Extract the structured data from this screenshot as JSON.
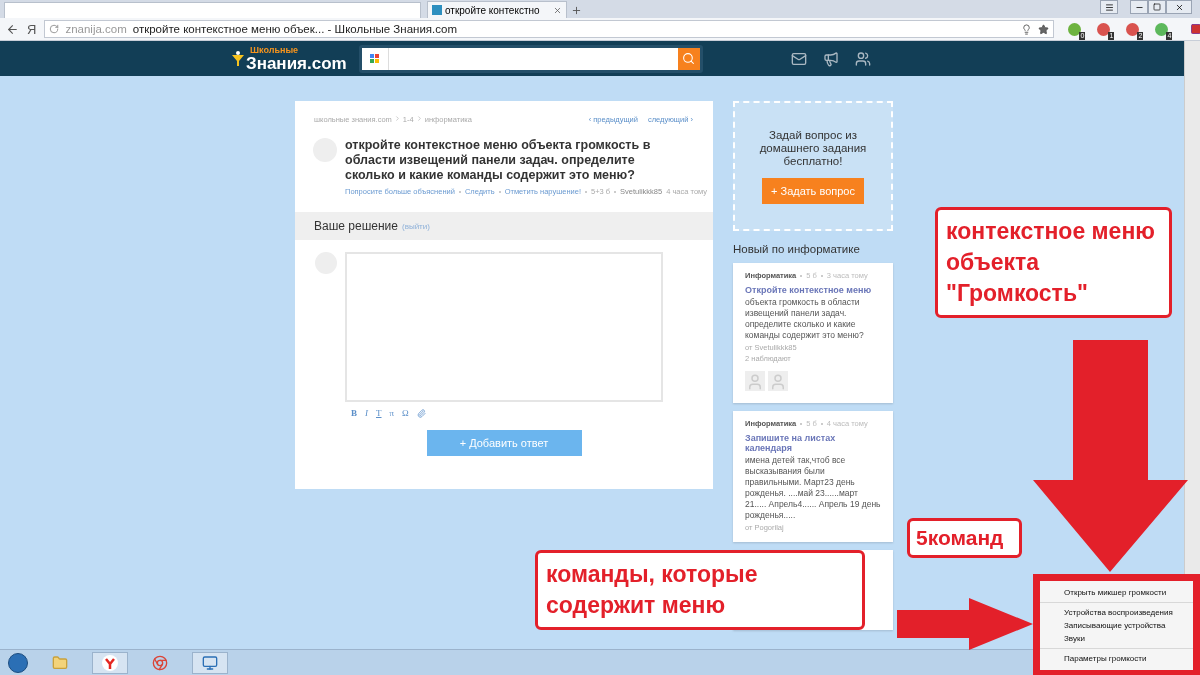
{
  "browser": {
    "tab": {
      "title": "откройте контекстно",
      "selected": true
    },
    "address": {
      "domain": "znanija.com",
      "title": "откройте контекстное меню объек... - Школьные Знания.com"
    },
    "back_label": "Я",
    "extensions": [
      {
        "badge": "0",
        "color": "#6db33f"
      },
      {
        "badge": "1",
        "color": "#d9534f"
      },
      {
        "badge": "2",
        "color": "#d9534f"
      },
      {
        "badge": "4",
        "color": "#5cb85c"
      }
    ]
  },
  "site": {
    "logo_top": "Школьные",
    "logo_main": "Знания.com"
  },
  "question": {
    "breadcrumbs": [
      "школьные знания.com",
      "1-4",
      "информатика"
    ],
    "prev": "‹ предыдущий",
    "next": "следующий ›",
    "title": "откройте контекстное меню объекта громкость в области извещений панели задач. определите сколько и какие команды содержит это меню?",
    "meta": [
      {
        "kind": "link",
        "text": "Попросите больше объяснений"
      },
      {
        "kind": "link",
        "text": "Следить"
      },
      {
        "kind": "link",
        "text": "Отметить нарушение!"
      },
      {
        "kind": "plain",
        "text": "5+3 б"
      },
      {
        "kind": "author",
        "text": "Svetulikkk85",
        "after": "4 часа тому"
      }
    ]
  },
  "answer": {
    "heading": "Ваше решение",
    "logout": "(выйти)",
    "tools": [
      "B",
      "I",
      "T",
      "π",
      "Ω"
    ],
    "submit": "+ Добавить ответ"
  },
  "ask": {
    "text": "Задай вопрос из домашнего задания бесплатно!",
    "button": "+ Задать вопрос"
  },
  "sidebar": {
    "heading": "Новый по информатике",
    "cards": [
      {
        "subject": "Информатика",
        "points": "5 б",
        "time": "3 часа тому",
        "title": "Откройте контекстное меню",
        "body": "объекта громкость в области извещений панели задач. определите сколько и какие команды содержит это меню?",
        "author": "от Svetulikkk85",
        "watchers": "2 наблюдают"
      },
      {
        "subject": "Информатика",
        "points": "5 б",
        "time": "4 часа тому",
        "title": "Запишите на листах календаря",
        "body": "имена детей так,чтоб все высказывания были правильными. Март23 день рожденья. ....май 23......март 21..... Апрель4...... Апрель 19 день рожденья.....",
        "author": "от Pogorilaj"
      }
    ]
  },
  "annotations": [
    {
      "kind": "callout",
      "text": "контекстное меню объекта \"Громкость\""
    },
    {
      "kind": "count",
      "text": "5команд"
    },
    {
      "kind": "callout",
      "text": "команды, которые содержит меню"
    }
  ],
  "context_menu": {
    "groups": [
      {
        "items": [
          "Открыть микшер громкости"
        ]
      },
      {
        "items": [
          "Устройства воспроизведения",
          "Записывающие устройства",
          "Звуки"
        ]
      },
      {
        "items": [
          "Параметры громкости"
        ]
      }
    ]
  }
}
